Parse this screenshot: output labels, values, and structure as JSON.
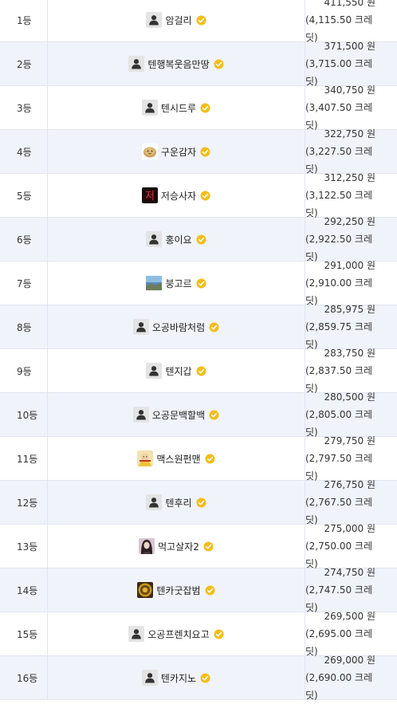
{
  "colors": {
    "row_alt": "#f1f3fb",
    "row_white": "#ffffff",
    "border": "#e2e5ef",
    "verified": "#f2be1a"
  },
  "ranking": [
    {
      "rank": "1등",
      "nickname": "암걸리",
      "amount": "411,550 원",
      "credits": "(4,115.50 크레딧)",
      "avatar": "default-user-icon"
    },
    {
      "rank": "2등",
      "nickname": "텐행복웃음만땅",
      "amount": "371,500 원",
      "credits": "(3,715.00 크레딧)",
      "avatar": "default-user-icon"
    },
    {
      "rank": "3등",
      "nickname": "텐시드루",
      "amount": "340,750 원",
      "credits": "(3,407.50 크레딧)",
      "avatar": "default-user-icon"
    },
    {
      "rank": "4등",
      "nickname": "구운감자",
      "amount": "322,750 원",
      "credits": "(3,227.50 크레딧)",
      "avatar": "potato-avatar"
    },
    {
      "rank": "5등",
      "nickname": "저승사자",
      "amount": "312,250 원",
      "credits": "(3,122.50 크레딧)",
      "avatar": "red-glyph-avatar"
    },
    {
      "rank": "6등",
      "nickname": "홍이요",
      "amount": "292,250 원",
      "credits": "(2,922.50 크레딧)",
      "avatar": "default-user-icon"
    },
    {
      "rank": "7등",
      "nickname": "붕고르",
      "amount": "291,000 원",
      "credits": "(2,910.00 크레딧)",
      "avatar": "landscape-avatar"
    },
    {
      "rank": "8등",
      "nickname": "오공바람처럼",
      "amount": "285,975 원",
      "credits": "(2,859.75 크레딧)",
      "avatar": "default-user-icon"
    },
    {
      "rank": "9등",
      "nickname": "텐지갑",
      "amount": "283,750 원",
      "credits": "(2,837.50 크레딧)",
      "avatar": "default-user-icon"
    },
    {
      "rank": "10등",
      "nickname": "오공문백할백",
      "amount": "280,500 원",
      "credits": "(2,805.00 크레딧)",
      "avatar": "default-user-icon"
    },
    {
      "rank": "11등",
      "nickname": "맥스원펀맨",
      "amount": "279,750 원",
      "credits": "(2,797.50 크레딧)",
      "avatar": "cartoon-avatar"
    },
    {
      "rank": "12등",
      "nickname": "텐후리",
      "amount": "276,750 원",
      "credits": "(2,767.50 크레딧)",
      "avatar": "default-user-icon"
    },
    {
      "rank": "13등",
      "nickname": "먹고살자2",
      "amount": "275,000 원",
      "credits": "(2,750.00 크레딧)",
      "avatar": "portrait-avatar"
    },
    {
      "rank": "14등",
      "nickname": "텐카굿잡범",
      "amount": "274,750 원",
      "credits": "(2,747.50 크레딧)",
      "avatar": "medallion-avatar"
    },
    {
      "rank": "15등",
      "nickname": "오공프렌치요고",
      "amount": "269,500 원",
      "credits": "(2,695.00 크레딧)",
      "avatar": "default-user-icon"
    },
    {
      "rank": "16등",
      "nickname": "텐카지노",
      "amount": "269,000 원",
      "credits": "(2,690.00 크레딧)",
      "avatar": "default-user-icon"
    }
  ]
}
